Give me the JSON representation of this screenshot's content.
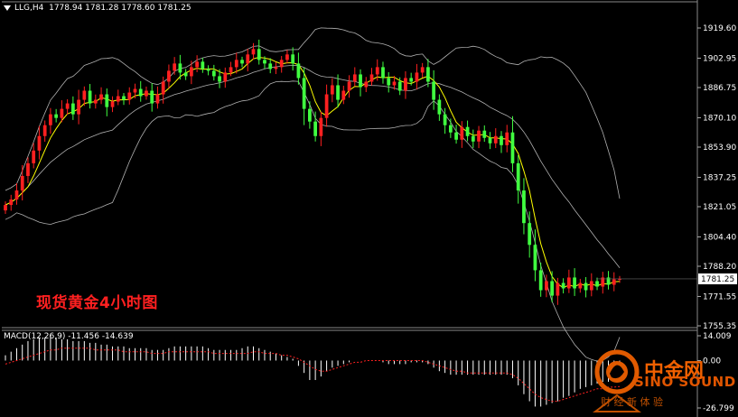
{
  "header": {
    "symbol_tf": "LLG,H4",
    "ohlc": "1778.94 1781.28 1778.60 1781.25"
  },
  "caption": "现货黄金4小时图",
  "macd": {
    "label": "MACD(12,26,9) -11.456 -14.639",
    "ticks": [
      "14.009",
      "0.00",
      "-26.799"
    ]
  },
  "price_axis": {
    "ticks": [
      "1919.60",
      "1902.95",
      "1886.75",
      "1870.10",
      "1853.90",
      "1837.25",
      "1821.05",
      "1804.40",
      "1788.20",
      "1771.55",
      "1755.35"
    ],
    "current": "1781.25"
  },
  "watermark": {
    "brand_cn": "中金网",
    "brand_en": "SINO SOUND",
    "slogan": "财 经 新 体 验",
    "colors": {
      "logo": "#e05a00"
    }
  },
  "colors": {
    "background": "#000000",
    "bull_candle": "#ff2020",
    "bear_candle": "#40ff40",
    "ma_fast": "#ffff00",
    "bands": "#b0b0b0",
    "macd_hist": "#ffffff",
    "macd_signal": "#ff2020"
  },
  "chart_data": {
    "type": "candlestick",
    "ylim": [
      1755.35,
      1924
    ],
    "closes": [
      1822,
      1825,
      1830,
      1838,
      1845,
      1852,
      1860,
      1866,
      1872,
      1870,
      1875,
      1878,
      1872,
      1880,
      1885,
      1878,
      1880,
      1883,
      1876,
      1879,
      1882,
      1880,
      1884,
      1886,
      1882,
      1885,
      1878,
      1883,
      1890,
      1896,
      1900,
      1895,
      1893,
      1898,
      1901,
      1897,
      1896,
      1893,
      1890,
      1895,
      1898,
      1902,
      1900,
      1905,
      1908,
      1902,
      1900,
      1897,
      1898,
      1902,
      1905,
      1900,
      1892,
      1875,
      1868,
      1860,
      1870,
      1883,
      1888,
      1880,
      1885,
      1890,
      1894,
      1887,
      1890,
      1894,
      1898,
      1892,
      1888,
      1890,
      1885,
      1892,
      1890,
      1895,
      1898,
      1890,
      1880,
      1872,
      1866,
      1862,
      1858,
      1865,
      1860,
      1857,
      1863,
      1859,
      1856,
      1860,
      1855,
      1862,
      1845,
      1830,
      1812,
      1800,
      1786,
      1775,
      1780,
      1772,
      1779,
      1776,
      1782,
      1776,
      1779,
      1775,
      1780,
      1777,
      1782,
      1778,
      1781,
      1781.25
    ],
    "volatility": 2.2,
    "macd_hist_range": [
      -26.799,
      14.009
    ],
    "macd_signal": [
      -2,
      -1,
      0,
      1,
      2,
      3,
      4,
      5,
      6,
      6,
      7,
      7,
      7,
      7,
      7,
      7,
      6,
      6,
      6,
      6,
      6,
      5,
      5,
      5,
      5,
      5,
      4,
      4,
      4,
      5,
      5,
      5,
      5,
      5,
      5,
      5,
      5,
      4,
      4,
      4,
      4,
      4,
      4,
      4,
      5,
      5,
      4,
      4,
      4,
      3,
      3,
      2,
      1,
      -1,
      -3,
      -5,
      -6,
      -6,
      -5,
      -4,
      -3,
      -2,
      -1,
      -1,
      0,
      0,
      0,
      0,
      0,
      0,
      0,
      0,
      0,
      0,
      0,
      -1,
      -2,
      -3,
      -4,
      -5,
      -6,
      -6,
      -7,
      -7,
      -7,
      -7,
      -7,
      -7,
      -7,
      -7,
      -8,
      -10,
      -13,
      -16,
      -19,
      -21,
      -22,
      -23,
      -23,
      -22,
      -21,
      -20,
      -19,
      -18,
      -17,
      -16,
      -16,
      -15,
      -15,
      -14.639
    ],
    "macd_hist": [
      3,
      5,
      7,
      9,
      11,
      12,
      13,
      13,
      14,
      13,
      12,
      12,
      11,
      11,
      11,
      10,
      10,
      9,
      9,
      8,
      8,
      8,
      7,
      7,
      7,
      7,
      6,
      6,
      6,
      7,
      8,
      8,
      8,
      8,
      8,
      8,
      7,
      6,
      6,
      6,
      6,
      6,
      7,
      8,
      8,
      7,
      6,
      5,
      4,
      3,
      2,
      1,
      -3,
      -7,
      -11,
      -11,
      -9,
      -6,
      -4,
      -3,
      -2,
      -1,
      0,
      0,
      0,
      0,
      0,
      -1,
      -2,
      -2,
      -2,
      -2,
      -1,
      -1,
      -1,
      -2,
      -4,
      -6,
      -7,
      -8,
      -8,
      -8,
      -8,
      -8,
      -8,
      -8,
      -8,
      -8,
      -8,
      -8,
      -10,
      -14,
      -19,
      -23,
      -26,
      -26,
      -25,
      -24,
      -23,
      -21,
      -20,
      -18,
      -16,
      -15,
      -14,
      -13,
      -12,
      -12,
      -11.5,
      -11.456
    ]
  }
}
